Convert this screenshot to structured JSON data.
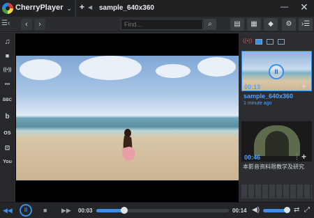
{
  "app": {
    "title": "CherryPlayer"
  },
  "tab": {
    "title": "sample_640x360",
    "new_tab": "+"
  },
  "window": {
    "minimize": "—",
    "close": "✕"
  },
  "toolbar": {
    "search_placeholder": "Find...",
    "back": "‹",
    "forward": "›"
  },
  "sidebar": {
    "items": [
      {
        "icon": "music-note-icon",
        "glyph": "♫"
      },
      {
        "icon": "video-camera-icon",
        "glyph": "■"
      },
      {
        "icon": "radio-icon",
        "glyph": "((•))"
      },
      {
        "icon": "more-icon",
        "glyph": "•••"
      },
      {
        "icon": "bbc-icon",
        "glyph": "BBC"
      },
      {
        "icon": "bandcamp-icon",
        "glyph": "b"
      },
      {
        "icon": "lastfm-icon",
        "glyph": "ᴏs"
      },
      {
        "icon": "twitch-icon",
        "glyph": "⊡"
      },
      {
        "icon": "youtube-icon",
        "glyph": "You"
      }
    ]
  },
  "playlist": {
    "items": [
      {
        "duration": "00:13",
        "title": "sample_640x360",
        "date": "1 minute ago"
      },
      {
        "duration": "00:46",
        "title": "本影音资料限教学及研究",
        "date": ""
      }
    ]
  },
  "player": {
    "current_time": "00:03",
    "total_time": "00:14",
    "progress": 0.21,
    "volume": 0.85
  },
  "colors": {
    "accent": "#3b8fe8",
    "background": "#2e3033"
  }
}
